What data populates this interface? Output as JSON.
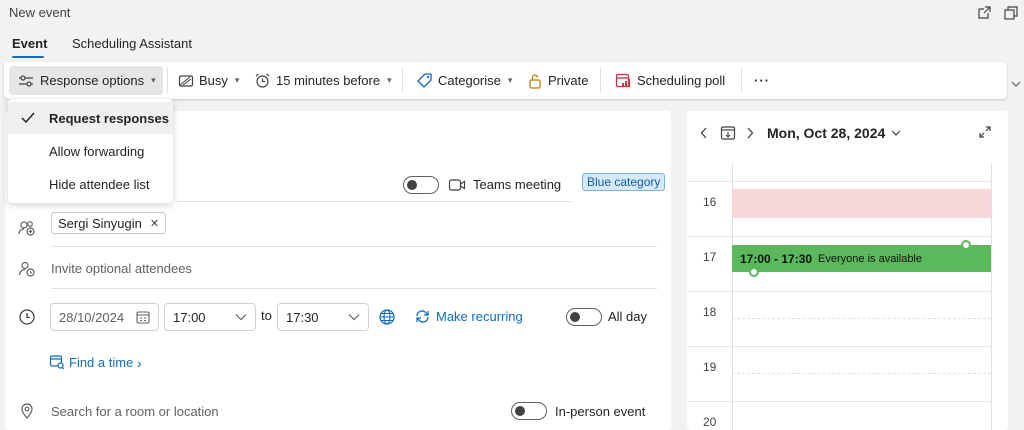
{
  "window": {
    "title": "New event"
  },
  "tabs": [
    {
      "label": "Event"
    },
    {
      "label": "Scheduling Assistant"
    }
  ],
  "toolbar": {
    "response_options": "Response options",
    "busy": "Busy",
    "reminder": "15 minutes before",
    "categorise": "Categorise",
    "private": "Private",
    "scheduling_poll": "Scheduling poll",
    "more": "···"
  },
  "response_menu": {
    "items": [
      {
        "label": "Request responses",
        "checked": true
      },
      {
        "label": "Allow forwarding",
        "checked": false
      },
      {
        "label": "Hide attendee list",
        "checked": false
      }
    ]
  },
  "form": {
    "teams_meeting": "Teams meeting",
    "category_badge": "Blue category",
    "attendee": "Sergi Sinyugin",
    "remove_glyph": "✕",
    "optional_placeholder": "Invite optional attendees",
    "start_date": "28/10/2024",
    "start_time": "17:00",
    "to_label": "to",
    "end_time": "17:30",
    "make_recurring": "Make recurring",
    "all_day": "All day",
    "find_a_time": "Find a time",
    "find_chevron": "›",
    "location_placeholder": "Search for a room or location",
    "in_person": "In-person event"
  },
  "calendar": {
    "date": "Mon, Oct 28, 2024",
    "hours": [
      "16",
      "17",
      "18",
      "19",
      "20"
    ],
    "event_time": "17:00 - 17:30",
    "event_text": "Everyone is available"
  },
  "colors": {
    "accent": "#0f6cbd",
    "available": "#5cb85c",
    "busy": "#f8d7da"
  }
}
